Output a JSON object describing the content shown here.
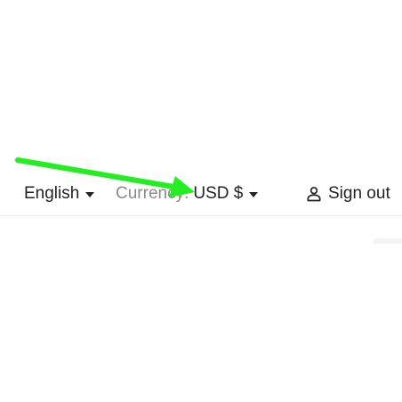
{
  "header": {
    "language": {
      "label": "English",
      "icon": "caret-down-icon"
    },
    "currency": {
      "label": "Currency:",
      "value": "USD $",
      "icon": "caret-down-icon"
    },
    "sign_out": {
      "label": "Sign out",
      "icon": "user-icon"
    }
  },
  "annotation": {
    "type": "arrow",
    "color": "#22ee22"
  }
}
